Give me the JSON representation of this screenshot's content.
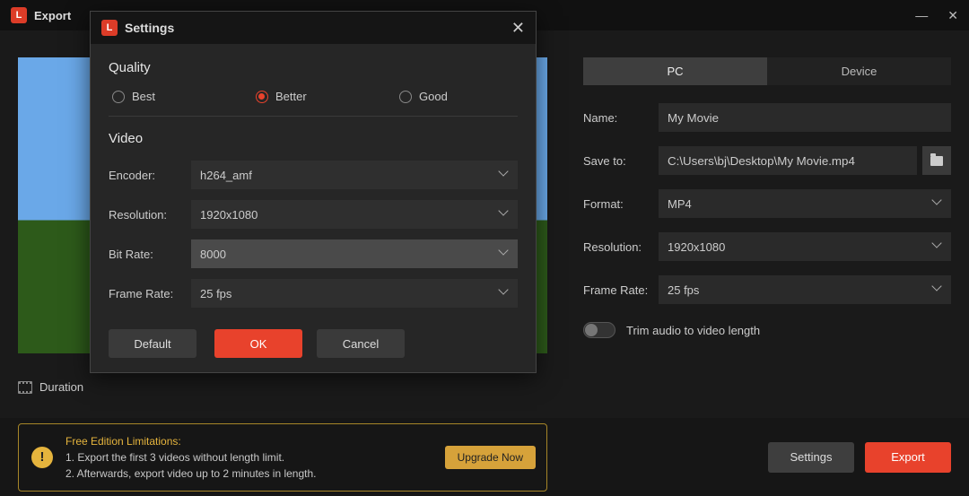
{
  "window": {
    "title": "Export"
  },
  "preview": {
    "duration_label": "Duration"
  },
  "right": {
    "tabs": {
      "pc": "PC",
      "device": "Device"
    },
    "name_label": "Name:",
    "name_value": "My Movie",
    "saveto_label": "Save to:",
    "saveto_value": "C:\\Users\\bj\\Desktop\\My Movie.mp4",
    "format_label": "Format:",
    "format_value": "MP4",
    "resolution_label": "Resolution:",
    "resolution_value": "1920x1080",
    "framerate_label": "Frame Rate:",
    "framerate_value": "25 fps",
    "trim_label": "Trim audio to video length"
  },
  "limitations": {
    "title": "Free Edition Limitations:",
    "line1": "1. Export the first 3 videos without length limit.",
    "line2": "2. Afterwards, export video up to 2 minutes in length.",
    "upgrade": "Upgrade Now"
  },
  "bottom": {
    "settings": "Settings",
    "export": "Export"
  },
  "modal": {
    "title": "Settings",
    "quality_heading": "Quality",
    "quality_options": {
      "best": "Best",
      "better": "Better",
      "good": "Good"
    },
    "video_heading": "Video",
    "encoder_label": "Encoder:",
    "encoder_value": "h264_amf",
    "resolution_label": "Resolution:",
    "resolution_value": "1920x1080",
    "bitrate_label": "Bit Rate:",
    "bitrate_value": "8000",
    "framerate_label": "Frame Rate:",
    "framerate_value": "25 fps",
    "default": "Default",
    "ok": "OK",
    "cancel": "Cancel"
  }
}
